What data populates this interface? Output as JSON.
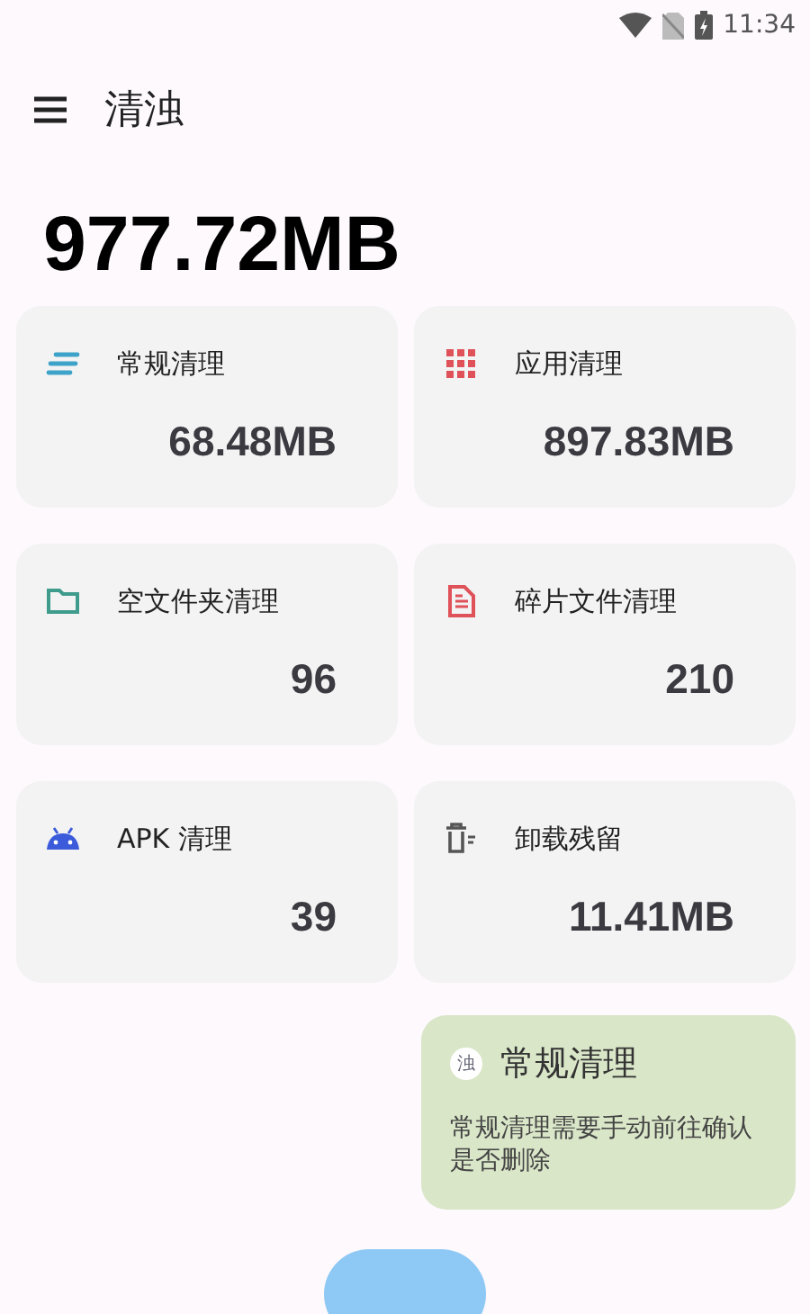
{
  "status_bar": {
    "time": "11:34"
  },
  "app_bar": {
    "title": "清浊"
  },
  "total": "977.72MB",
  "cards": [
    {
      "kind": "lines",
      "color": "#3ea3c8",
      "title": "常规清理",
      "value": "68.48MB"
    },
    {
      "kind": "grid",
      "color": "#e0525a",
      "title": "应用清理",
      "value": "897.83MB"
    },
    {
      "kind": "folder",
      "color": "#3f9c8c",
      "title": "空文件夹清理",
      "value": "96"
    },
    {
      "kind": "document",
      "color": "#e0525a",
      "title": "碎片文件清理",
      "value": "210"
    },
    {
      "kind": "android",
      "color": "#3b5bdb",
      "title": "APK 清理",
      "value": "39"
    },
    {
      "kind": "trash",
      "color": "#555555",
      "title": "卸载残留",
      "value": "11.41MB"
    }
  ],
  "toast": {
    "app_icon_text": "浊",
    "title": "常规清理",
    "message": "常规清理需要手动前往确认是否删除"
  }
}
